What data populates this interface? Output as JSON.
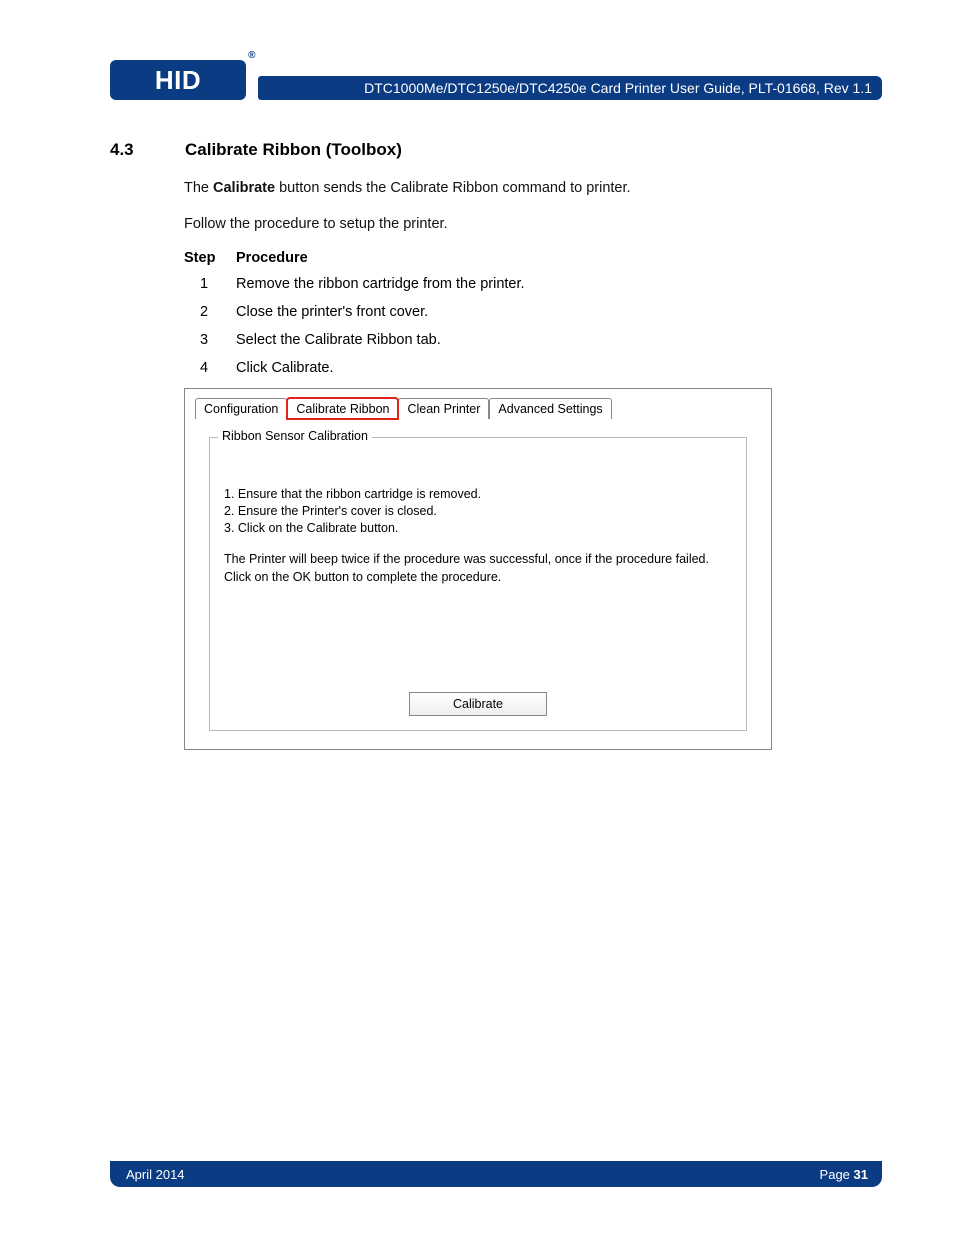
{
  "header": {
    "logo_text": "HID",
    "reg_mark": "®",
    "title": "DTC1000Me/DTC1250e/DTC4250e Card Printer User Guide, PLT-01668, Rev 1.1"
  },
  "section": {
    "number": "4.3",
    "title": "Calibrate Ribbon (Toolbox)",
    "intro_1_pre": "The ",
    "intro_1_bold": "Calibrate",
    "intro_1_post": " button sends the Calibrate Ribbon command to printer.",
    "intro_2": "Follow the procedure to setup the printer.",
    "col_step": "Step",
    "col_proc": "Procedure",
    "steps": [
      {
        "n": "1",
        "t": "Remove the ribbon cartridge from the printer."
      },
      {
        "n": "2",
        "t": "Close the printer's front cover."
      },
      {
        "n": "3",
        "t": "Select the Calibrate Ribbon tab."
      },
      {
        "n": "4",
        "t": "Click Calibrate."
      }
    ]
  },
  "dialog": {
    "tabs": {
      "configuration": "Configuration",
      "calibrate_ribbon": "Calibrate Ribbon",
      "clean_printer": "Clean Printer",
      "advanced_settings": "Advanced Settings"
    },
    "fieldset_legend": "Ribbon Sensor Calibration",
    "line1": "1. Ensure that the ribbon cartridge is removed.",
    "line2": "2. Ensure the Printer's cover is closed.",
    "line3": "3. Click on the Calibrate button.",
    "para1": "The Printer will beep twice if the procedure was successful, once if the procedure failed.",
    "para2": "Click on the OK button to complete the procedure.",
    "calibrate_button": "Calibrate"
  },
  "footer": {
    "date": "April 2014",
    "page_label": "Page ",
    "page_number": "31"
  }
}
